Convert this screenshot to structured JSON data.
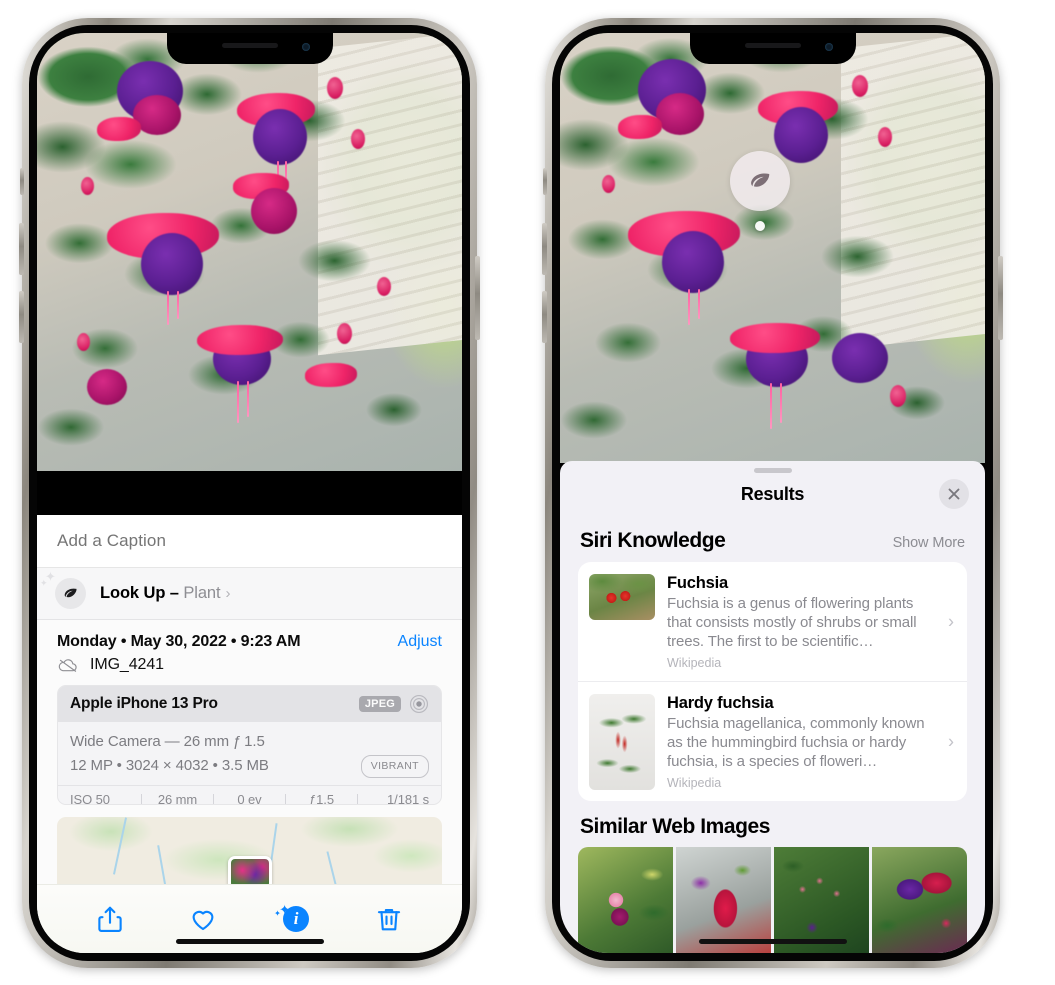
{
  "left_phone": {
    "caption": {
      "placeholder": "Add a Caption",
      "value": ""
    },
    "look_up": {
      "label": "Look Up",
      "dash": "–",
      "kind": "Plant",
      "chevron": "›",
      "icon": "leaf-icon",
      "sparkle": "✦",
      "sparkle_small": "✦"
    },
    "date_row": {
      "date": "Monday • May 30, 2022 • 9:23 AM",
      "adjust": "Adjust"
    },
    "file_row": {
      "name": "IMG_4241",
      "icon": "icloud-slash-icon"
    },
    "camera_card": {
      "model": "Apple iPhone 13 Pro",
      "format_badge": "JPEG",
      "lens_icon": "aperture-icon",
      "lens_line": "Wide Camera — 26 mm ƒ 1.5",
      "specs_line": "12 MP • 3024 × 4032 • 3.5 MB",
      "style_badge": "VIBRANT",
      "exif": [
        "ISO 50",
        "26 mm",
        "0 ev",
        "ƒ1.5",
        "1/181 s"
      ]
    },
    "map": {
      "pin": "photo-thumbnail-pin"
    },
    "toolbar": [
      {
        "name": "share-button",
        "icon": "share-icon"
      },
      {
        "name": "favorite-button",
        "icon": "heart-icon"
      },
      {
        "name": "info-button",
        "icon": "info-sparkle-icon",
        "glyph": "i"
      },
      {
        "name": "delete-button",
        "icon": "trash-icon"
      }
    ]
  },
  "right_phone": {
    "visual_lookup_badge": {
      "icon": "leaf-icon"
    },
    "sheet": {
      "title": "Results",
      "close_icon": "close-icon",
      "siri_knowledge": {
        "title": "Siri Knowledge",
        "action": "Show More",
        "items": [
          {
            "title": "Fuchsia",
            "description": "Fuchsia is a genus of flowering plants that consists mostly of shrubs or small trees. The first to be scientific…",
            "source": "Wikipedia",
            "chevron": "›"
          },
          {
            "title": "Hardy fuchsia",
            "description": "Fuchsia magellanica, commonly known as the hummingbird fuchsia or hardy fuchsia, is a species of floweri…",
            "source": "Wikipedia",
            "chevron": "›"
          }
        ]
      },
      "similar_web_images": {
        "title": "Similar Web Images",
        "tiles": [
          "web-image-1",
          "web-image-2",
          "web-image-3",
          "web-image-4"
        ]
      }
    }
  },
  "colors": {
    "accent_blue": "#0a84ff",
    "sheet_bg": "#f2f1f6",
    "panel_bg": "#fbfbfb",
    "card_bg": "#f0f0f2",
    "secondary_text": "#8a8a90"
  }
}
